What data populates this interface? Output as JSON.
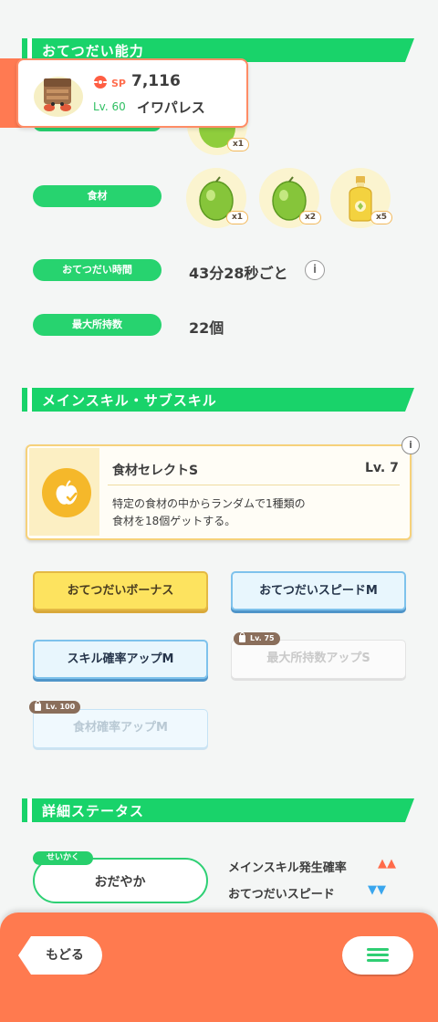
{
  "header_card": {
    "sp_label": "SP",
    "sp_value": "7,116",
    "level": "Lv. 60",
    "name": "イワパレス"
  },
  "helping_ability": {
    "section_title": "おてつだい能力",
    "berry_qty": "x1",
    "ingredients_label": "食材",
    "ingredients": [
      {
        "icon": "lime-icon",
        "qty": "x1"
      },
      {
        "icon": "lime-icon",
        "qty": "x2"
      },
      {
        "icon": "oil-bottle-icon",
        "qty": "x5"
      }
    ],
    "time_label": "おてつだい時間",
    "time_value": "43分28秒ごと",
    "capacity_label": "最大所持数",
    "capacity_value": "22個"
  },
  "skills": {
    "section_title": "メインスキル・サブスキル",
    "main_skill": {
      "name": "食材セレクトS",
      "level": "Lv. 7",
      "description_line1": "特定の食材の中からランダムで1種類の",
      "description_line2": "食材を18個ゲットする。"
    },
    "sub_skills": [
      {
        "label": "おてつだいボーナス",
        "style": "gold",
        "lock": ""
      },
      {
        "label": "おてつだいスピードM",
        "style": "blue",
        "lock": ""
      },
      {
        "label": "スキル確率アップM",
        "style": "blue",
        "lock": ""
      },
      {
        "label": "最大所持数アップS",
        "style": "grey",
        "lock": "Lv. 75"
      },
      {
        "label": "食材確率アップM",
        "style": "paleblue",
        "lock": "Lv. 100"
      }
    ]
  },
  "details": {
    "section_title": "詳細ステータス",
    "nature_tag": "せいかく",
    "nature_value": "おだやか",
    "effects": [
      {
        "label": "メインスキル発生確率",
        "symbol": "▲▲",
        "color": "#ff6b4a"
      },
      {
        "label": "おてつだいスピード",
        "symbol": "▼▼",
        "color": "#3aa6ee"
      }
    ]
  },
  "nav": {
    "back_label": "もどる"
  },
  "colors": {
    "accent_green": "#19d36a",
    "orange": "#ff7a4f",
    "gold": "#fde35f",
    "blue": "#7ec2ec"
  }
}
